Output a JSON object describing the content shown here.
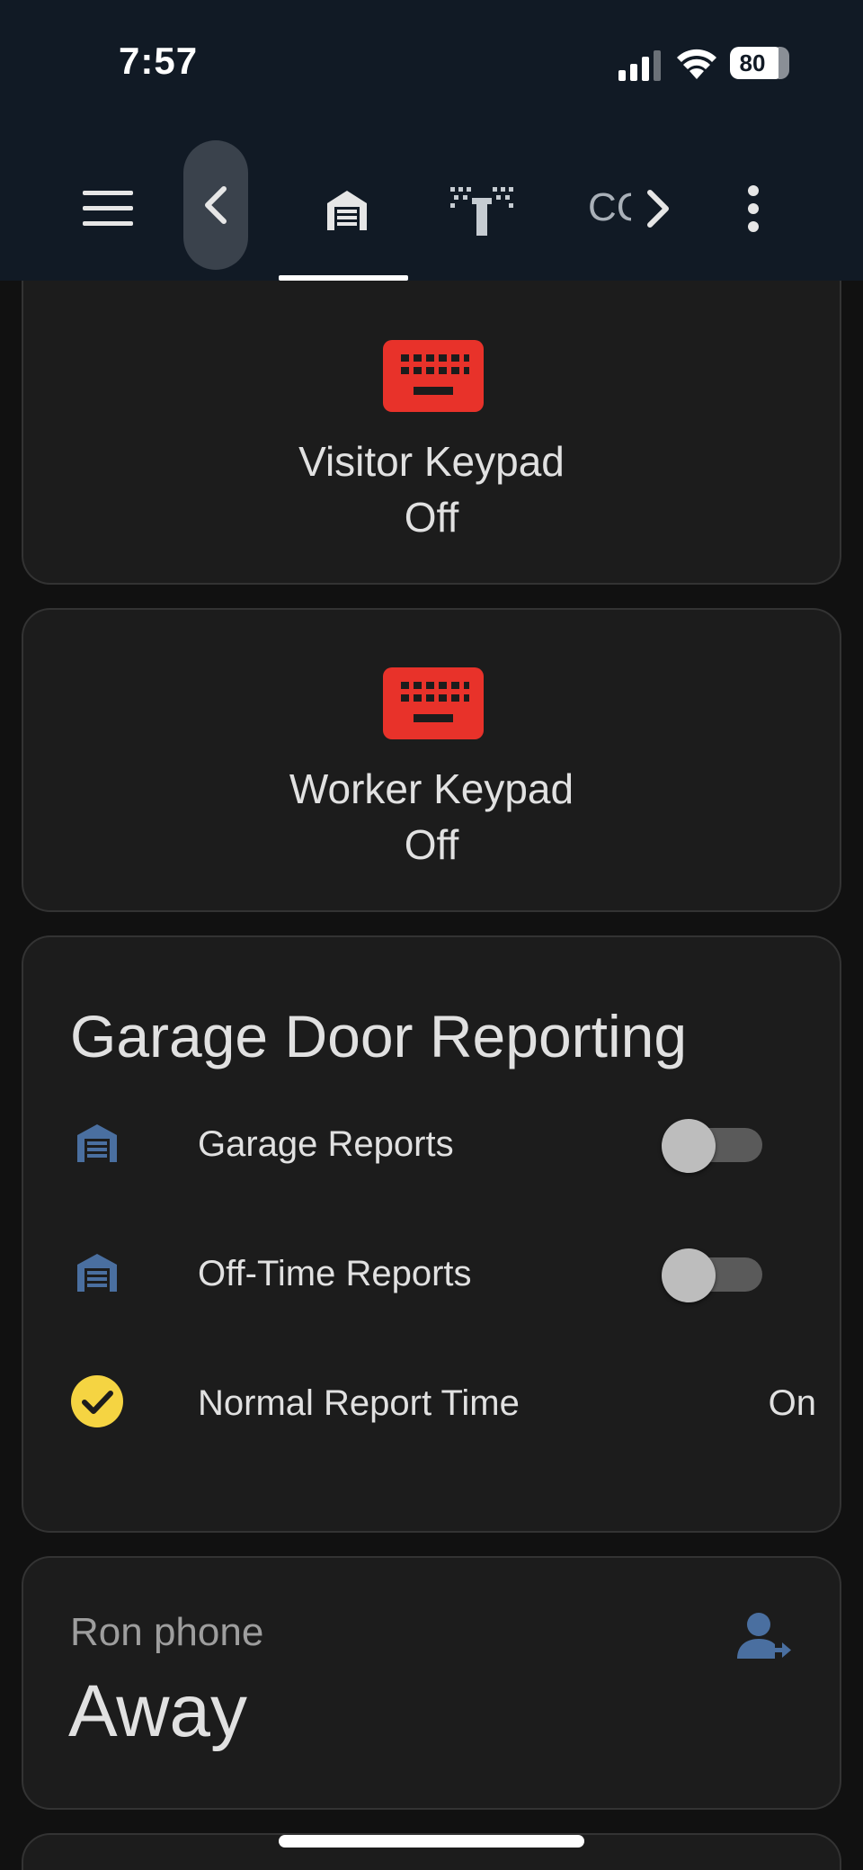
{
  "status_bar": {
    "time": "7:57",
    "battery_level": "80"
  },
  "toolbar": {
    "menu_icon": "hamburger-menu-icon",
    "scroll_left_icon": "chevron-left-icon",
    "tabs": [
      {
        "icon": "garage-icon",
        "selected": true
      },
      {
        "icon": "sprinkler-icon",
        "selected": false
      },
      {
        "label": "CC",
        "selected": false
      }
    ],
    "scroll_right_icon": "chevron-right-icon",
    "overflow_icon": "more-vertical-icon"
  },
  "cards": {
    "visitor_keypad": {
      "name": "Visitor Keypad",
      "state": "Off",
      "icon": "keyboard-icon",
      "icon_color": "#e8322a"
    },
    "worker_keypad": {
      "name": "Worker Keypad",
      "state": "Off",
      "icon": "keyboard-icon",
      "icon_color": "#e8322a"
    },
    "garage_reporting": {
      "title": "Garage Door Reporting",
      "rows": [
        {
          "label": "Garage Reports",
          "icon": "garage-icon",
          "icon_color": "#4a6fa0",
          "toggle_on": false
        },
        {
          "label": "Off-Time Reports",
          "icon": "garage-icon",
          "icon_color": "#4a6fa0",
          "toggle_on": false
        },
        {
          "label": "Normal Report Time",
          "icon": "check-circle-icon",
          "icon_color": "#f5d442",
          "value": "On"
        }
      ]
    },
    "person": {
      "name": "Ron phone",
      "state": "Away",
      "icon": "account-arrow-right-icon",
      "icon_color": "#4a6fa0"
    }
  },
  "colors": {
    "app_bar": "#111a25",
    "background": "#111111",
    "card": "#1c1c1c",
    "active": "#4a6fa0"
  }
}
